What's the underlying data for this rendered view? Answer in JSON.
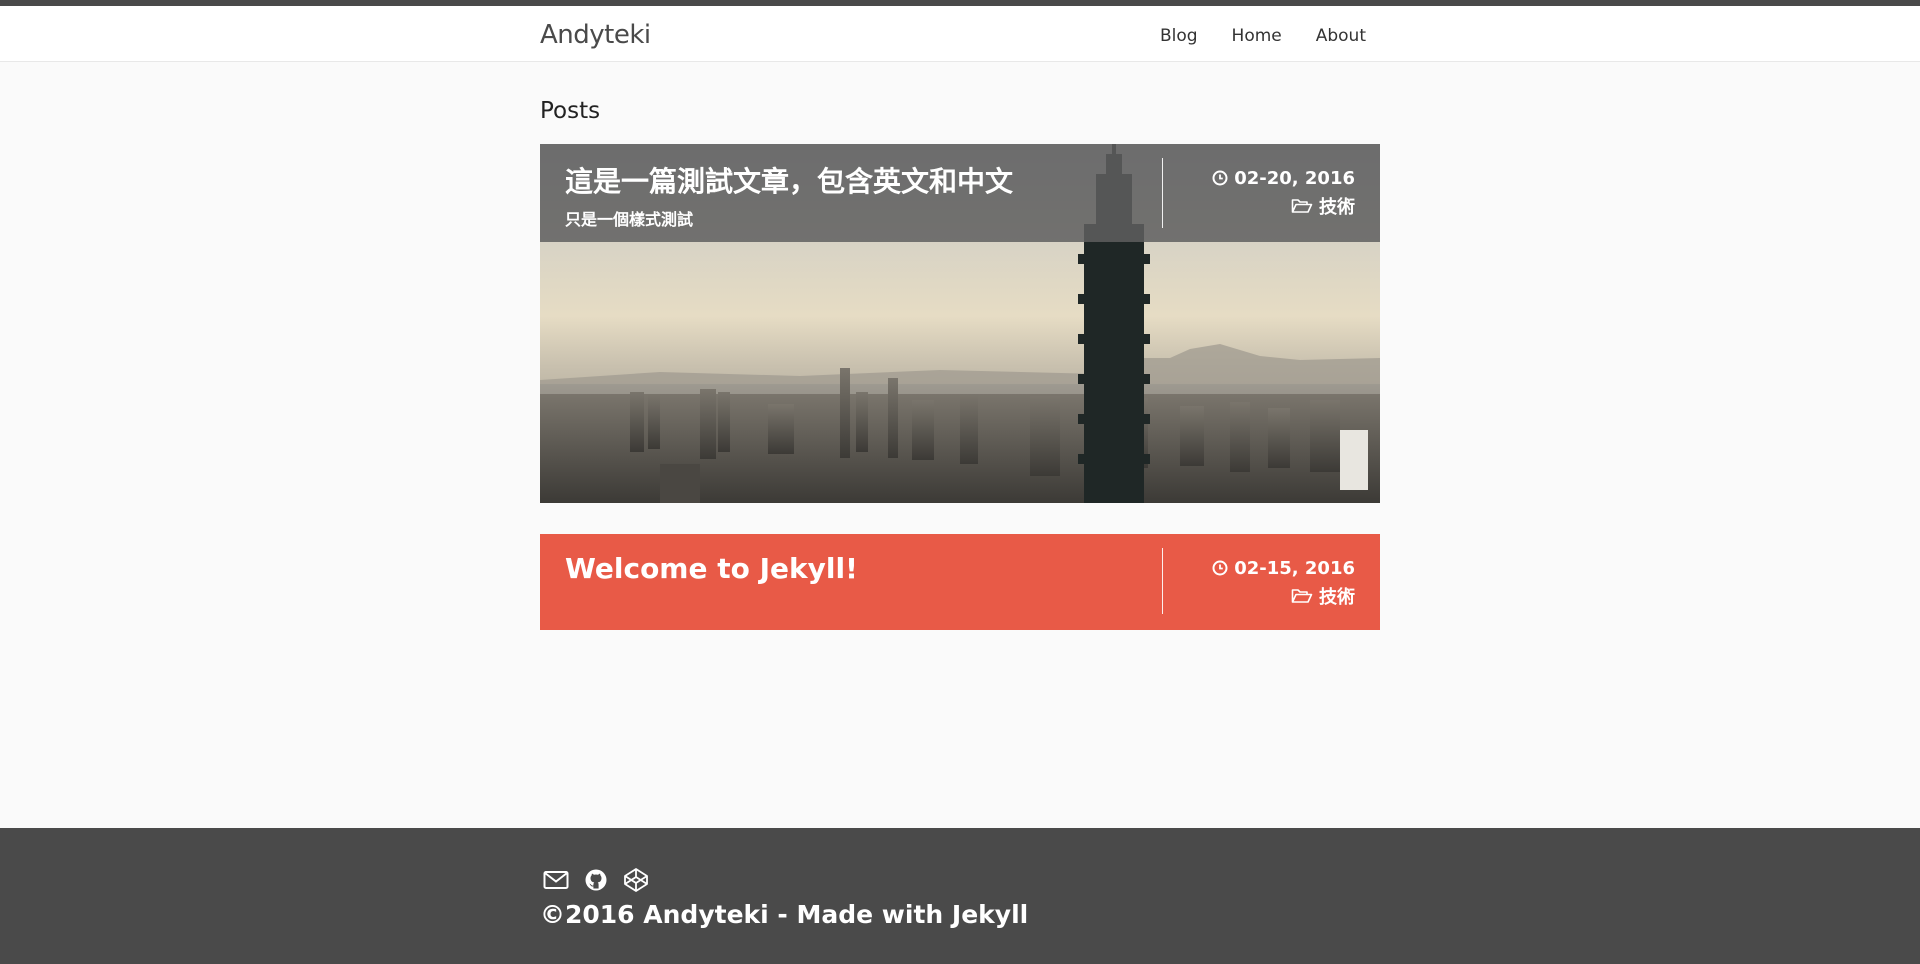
{
  "site": {
    "brand": "Andyteki"
  },
  "nav": {
    "items": [
      "Blog",
      "Home",
      "About"
    ]
  },
  "main": {
    "section_title": "Posts",
    "posts": [
      {
        "title": "這是一篇測試文章，包含英文和中文",
        "subtitle": "只是一個樣式測試",
        "date": "02-20, 2016",
        "category": "技術",
        "date_icon": "clock-icon",
        "category_icon": "folder-open-icon",
        "background": "city-skyline-photo"
      },
      {
        "title": "Welcome to Jekyll!",
        "date": "02-15, 2016",
        "category": "技術",
        "date_icon": "clock-icon",
        "category_icon": "folder-open-icon",
        "accent_color": "#e85a47"
      }
    ]
  },
  "footer": {
    "icons": [
      "mail-icon",
      "github-icon",
      "codepen-icon"
    ],
    "copyright": "©2016 Andyteki - Made with Jekyll",
    "background_color": "#4a4a4a"
  }
}
